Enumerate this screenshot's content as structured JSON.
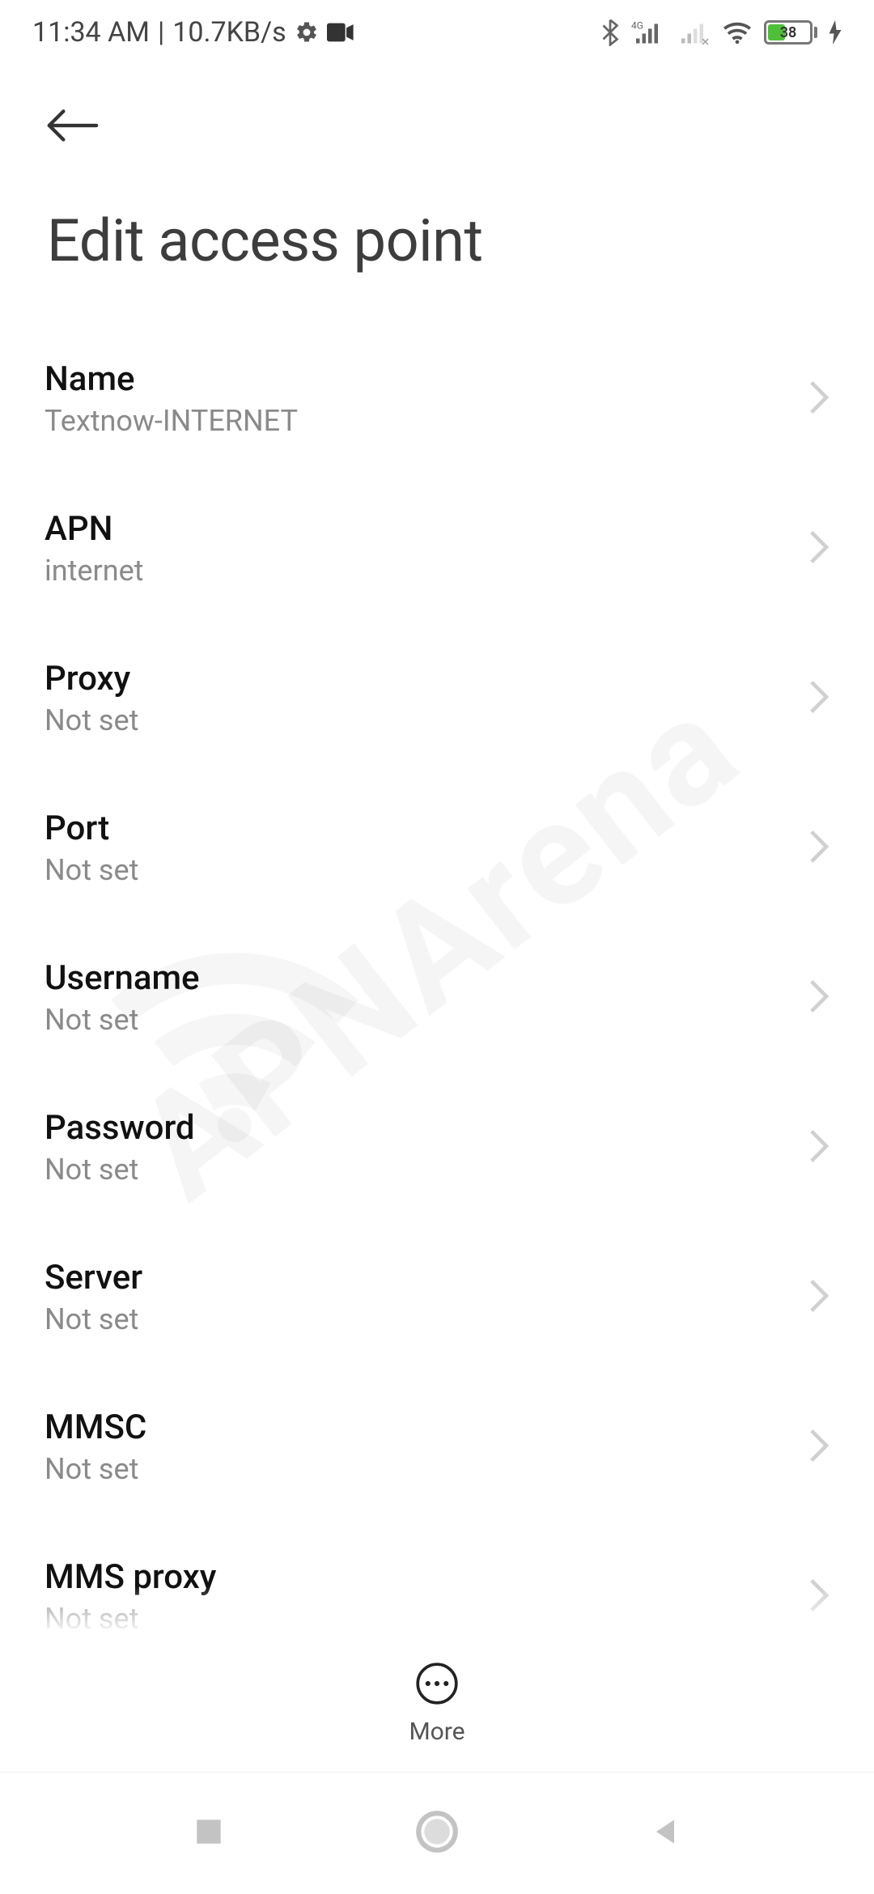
{
  "status": {
    "time": "11:34 AM",
    "net_speed": "10.7KB/s",
    "battery_percent": "38"
  },
  "header": {
    "title": "Edit access point"
  },
  "fields": {
    "name": {
      "label": "Name",
      "value": "Textnow-INTERNET"
    },
    "apn": {
      "label": "APN",
      "value": "internet"
    },
    "proxy": {
      "label": "Proxy",
      "value": "Not set"
    },
    "port": {
      "label": "Port",
      "value": "Not set"
    },
    "username": {
      "label": "Username",
      "value": "Not set"
    },
    "password": {
      "label": "Password",
      "value": "Not set"
    },
    "server": {
      "label": "Server",
      "value": "Not set"
    },
    "mmsc": {
      "label": "MMSC",
      "value": "Not set"
    },
    "mms_proxy": {
      "label": "MMS proxy",
      "value": "Not set"
    }
  },
  "action": {
    "more_label": "More"
  },
  "watermark": "APNArena"
}
